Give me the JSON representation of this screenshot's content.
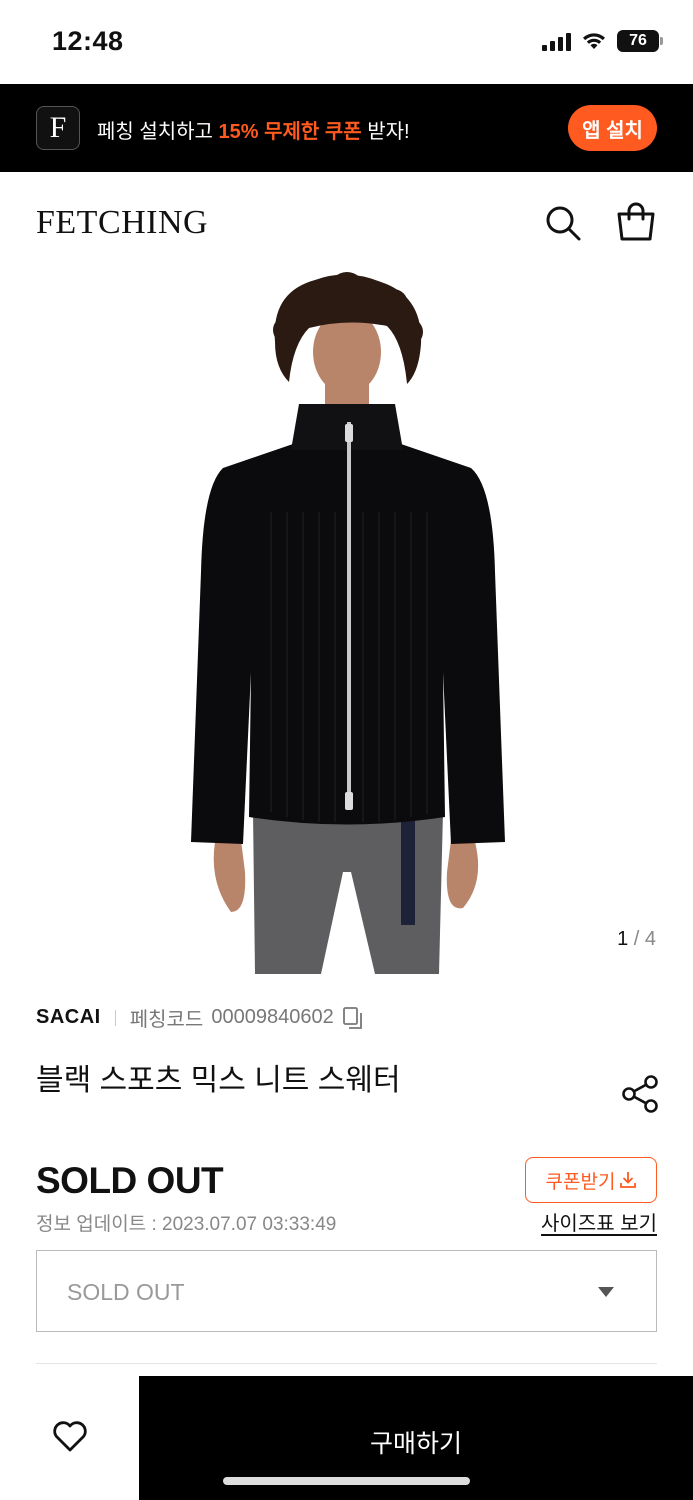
{
  "status_bar": {
    "time": "12:48",
    "battery_level": "76",
    "icons": [
      "signal-icon",
      "wifi-icon",
      "battery-icon"
    ]
  },
  "promo_banner": {
    "logo_letter": "F",
    "text_before": "페칭 설치하고 ",
    "text_accent": "15% 무제한 쿠폰",
    "text_after": " 받자!",
    "button_label": "앱 설치",
    "accent_color": "#ff5a1f"
  },
  "header": {
    "logo": "FETCHING",
    "icons": [
      "search-icon",
      "shopping-bag-icon"
    ]
  },
  "product": {
    "image_alt": "product-photo",
    "image_index": "1",
    "image_separator": " / ",
    "image_total": "4",
    "brand": "SACAI",
    "code_label": "페칭코드",
    "code_value": "00009840602",
    "title": "블랙 스포츠 믹스 니트 스웨터",
    "price": "SOLD OUT",
    "update_label": "정보 업데이트 : ",
    "update_time": "2023.07.07 03:33:49",
    "coupon_label": "쿠폰받기",
    "size_chart_label": "사이즈표 보기",
    "option_value": "SOLD OUT"
  },
  "bottom_bar": {
    "buy_label": "구매하기"
  }
}
